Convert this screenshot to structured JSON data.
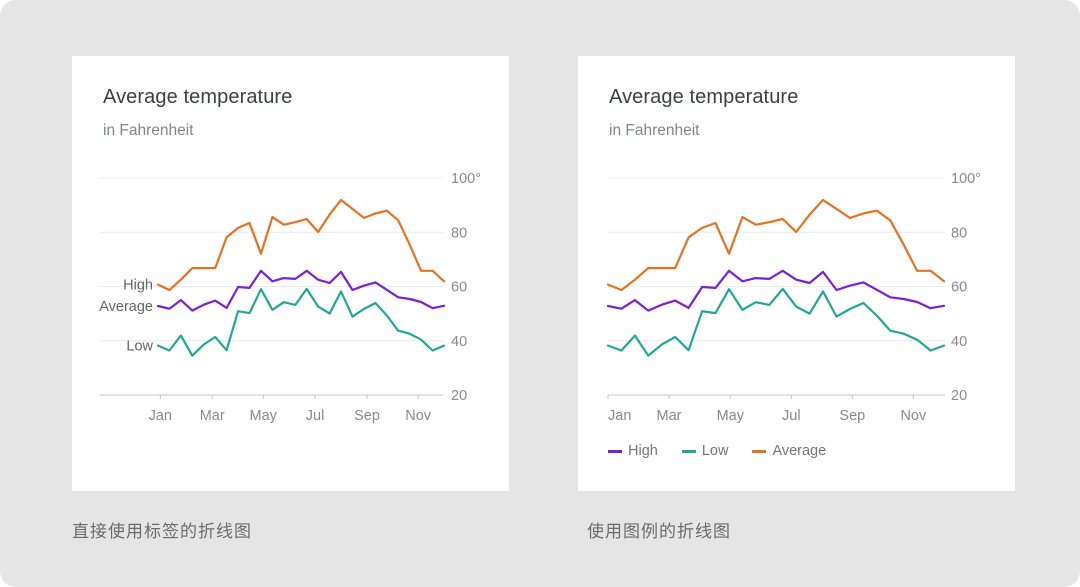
{
  "chart_data": [
    {
      "type": "line",
      "variant": "direct-labels",
      "title": "Average temperature",
      "subtitle": "in Fahrenheit",
      "xlabel": "",
      "ylabel": "",
      "ylim": [
        20,
        100
      ],
      "yticks": [
        100,
        80,
        60,
        40,
        20
      ],
      "ytick_labels": [
        "100°",
        "80",
        "60",
        "40",
        "20"
      ],
      "xlim": [
        0,
        25
      ],
      "xticks": [
        0.2,
        4.74,
        9.2,
        13.73,
        18.27,
        22.74
      ],
      "xtick_labels": [
        "Jan",
        "Mar",
        "May",
        "Jul",
        "Sep",
        "Nov"
      ],
      "grid": true,
      "legend": "direct-labels-left",
      "x": [
        0,
        1,
        2,
        3,
        4,
        5,
        6,
        7,
        8,
        9,
        10,
        11,
        12,
        13,
        14,
        15,
        16,
        17,
        18,
        19,
        20,
        21,
        22,
        23,
        24,
        25
      ],
      "series": [
        {
          "name": "High",
          "color": "#e8711f",
          "label": "High",
          "values": [
            60.7,
            58.7,
            62.5,
            66.8,
            66.8,
            66.8,
            78.1,
            81.6,
            83.4,
            72.1,
            85.6,
            82.8,
            83.7,
            84.9,
            80.1,
            86.5,
            91.9,
            88.6,
            85.3,
            86.9,
            88.0,
            84.4,
            75.4,
            65.8,
            65.8,
            61.9
          ]
        },
        {
          "name": "Average",
          "color": "#7b1fd8",
          "label": "Average",
          "values": [
            52.8,
            51.8,
            55.0,
            51.1,
            53.3,
            54.8,
            52.1,
            59.8,
            59.5,
            65.8,
            61.9,
            63.1,
            62.8,
            65.8,
            62.5,
            61.3,
            65.4,
            58.7,
            60.3,
            61.5,
            58.8,
            56.0,
            55.4,
            54.3,
            52.0,
            52.9
          ]
        },
        {
          "name": "Low",
          "color": "#1fa898",
          "label": "Low",
          "values": [
            38.2,
            36.4,
            41.9,
            34.5,
            38.6,
            41.4,
            36.5,
            50.9,
            50.2,
            59.0,
            51.4,
            54.2,
            53.2,
            59.1,
            52.6,
            50.0,
            58.2,
            48.9,
            51.7,
            53.9,
            49.3,
            43.7,
            42.6,
            40.4,
            36.4,
            38.2
          ]
        }
      ]
    },
    {
      "type": "line",
      "variant": "legend",
      "title": "Average temperature",
      "subtitle": "in Fahrenheit",
      "xlabel": "",
      "ylabel": "",
      "ylim": [
        20,
        100
      ],
      "yticks": [
        100,
        80,
        60,
        40,
        20
      ],
      "ytick_labels": [
        "100°",
        "80",
        "60",
        "40",
        "20"
      ],
      "xlim": [
        0,
        25
      ],
      "xticks": [
        0,
        4.54,
        9.1,
        13.64,
        18.18,
        22.72
      ],
      "xtick_labels": [
        "Jan",
        "Mar",
        "May",
        "Jul",
        "Sep",
        "Nov"
      ],
      "grid": true,
      "legend": "bottom-left",
      "legend_entries": [
        {
          "name": "High",
          "color": "#7b1fd8"
        },
        {
          "name": "Low",
          "color": "#1fa898"
        },
        {
          "name": "Average",
          "color": "#e8711f"
        }
      ],
      "x": [
        0,
        1,
        2,
        3,
        4,
        5,
        6,
        7,
        8,
        9,
        10,
        11,
        12,
        13,
        14,
        15,
        16,
        17,
        18,
        19,
        20,
        21,
        22,
        23,
        24,
        25
      ],
      "series": [
        {
          "name": "Average",
          "color": "#e8711f",
          "values": [
            60.7,
            58.7,
            62.5,
            66.8,
            66.8,
            66.8,
            78.1,
            81.6,
            83.4,
            72.1,
            85.6,
            82.8,
            83.7,
            84.9,
            80.1,
            86.5,
            91.9,
            88.6,
            85.3,
            86.9,
            88.0,
            84.4,
            75.4,
            65.8,
            65.8,
            61.9
          ]
        },
        {
          "name": "High",
          "color": "#7b1fd8",
          "values": [
            52.8,
            51.8,
            55.0,
            51.1,
            53.3,
            54.8,
            52.1,
            59.8,
            59.5,
            65.8,
            61.9,
            63.1,
            62.8,
            65.8,
            62.5,
            61.3,
            65.4,
            58.7,
            60.3,
            61.5,
            58.8,
            56.0,
            55.4,
            54.3,
            52.0,
            52.9
          ]
        },
        {
          "name": "Low",
          "color": "#1fa898",
          "values": [
            38.2,
            36.4,
            41.9,
            34.5,
            38.6,
            41.4,
            36.5,
            50.9,
            50.2,
            59.0,
            51.4,
            54.2,
            53.2,
            59.1,
            52.6,
            50.0,
            58.2,
            48.9,
            51.7,
            53.9,
            49.3,
            43.7,
            42.6,
            40.4,
            36.4,
            38.2
          ]
        }
      ]
    }
  ],
  "captions": {
    "left": "直接使用标签的折线图",
    "right": "使用图例的折线图"
  }
}
